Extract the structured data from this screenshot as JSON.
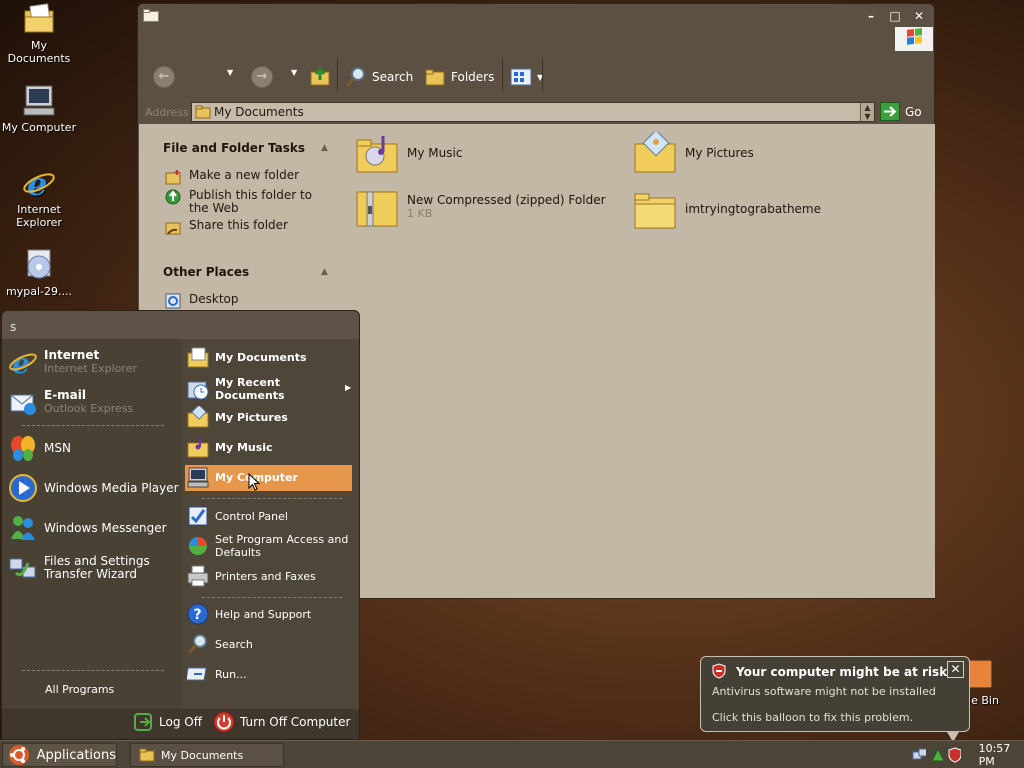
{
  "desktop": {
    "icons": [
      {
        "label": "My Documents"
      },
      {
        "label": "My Computer"
      },
      {
        "label": "Internet Explorer"
      },
      {
        "label": "mypal-29...."
      }
    ],
    "recycle_label": "cle Bin"
  },
  "window": {
    "toolbar": {
      "search": "Search",
      "folders": "Folders"
    },
    "address": {
      "label": "Address",
      "value": "My Documents",
      "go": "Go"
    },
    "tasks": {
      "header": "File and Folder Tasks",
      "items": [
        "Make a new folder",
        "Publish this folder to the Web",
        "Share this folder"
      ]
    },
    "other_places": {
      "header": "Other Places",
      "items": [
        "Desktop"
      ]
    },
    "files": [
      {
        "name": "My Music",
        "sub": ""
      },
      {
        "name": "My Pictures",
        "sub": ""
      },
      {
        "name": "New Compressed (zipped) Folder",
        "sub": "1 KB"
      },
      {
        "name": "imtryingtograbatheme",
        "sub": ""
      }
    ]
  },
  "start_menu": {
    "user": "s",
    "pinned": [
      {
        "title": "Internet",
        "sub": "Internet Explorer"
      },
      {
        "title": "E-mail",
        "sub": "Outlook Express"
      }
    ],
    "recent": [
      "MSN",
      "Windows Media Player",
      "Windows Messenger",
      "Files and Settings Transfer Wizard"
    ],
    "all_programs": "All Programs",
    "places": [
      "My Documents",
      "My Recent Documents",
      "My Pictures",
      "My Music",
      "My Computer"
    ],
    "system": [
      "Control Panel",
      "Set Program Access and Defaults",
      "Printers and Faxes"
    ],
    "help": [
      "Help and Support",
      "Search",
      "Run..."
    ],
    "log_off": "Log Off",
    "turn_off": "Turn Off Computer"
  },
  "taskbar": {
    "start": "Applications",
    "task": "My Documents",
    "clock": "10:57 PM"
  },
  "balloon": {
    "title": "Your computer might be at risk",
    "line1": "Antivirus software might not be installed",
    "line2": "Click this balloon to fix this problem."
  },
  "colors": {
    "highlight": "#e6974b",
    "window_bg": "#c3b8a6",
    "frame": "#5c5042"
  }
}
